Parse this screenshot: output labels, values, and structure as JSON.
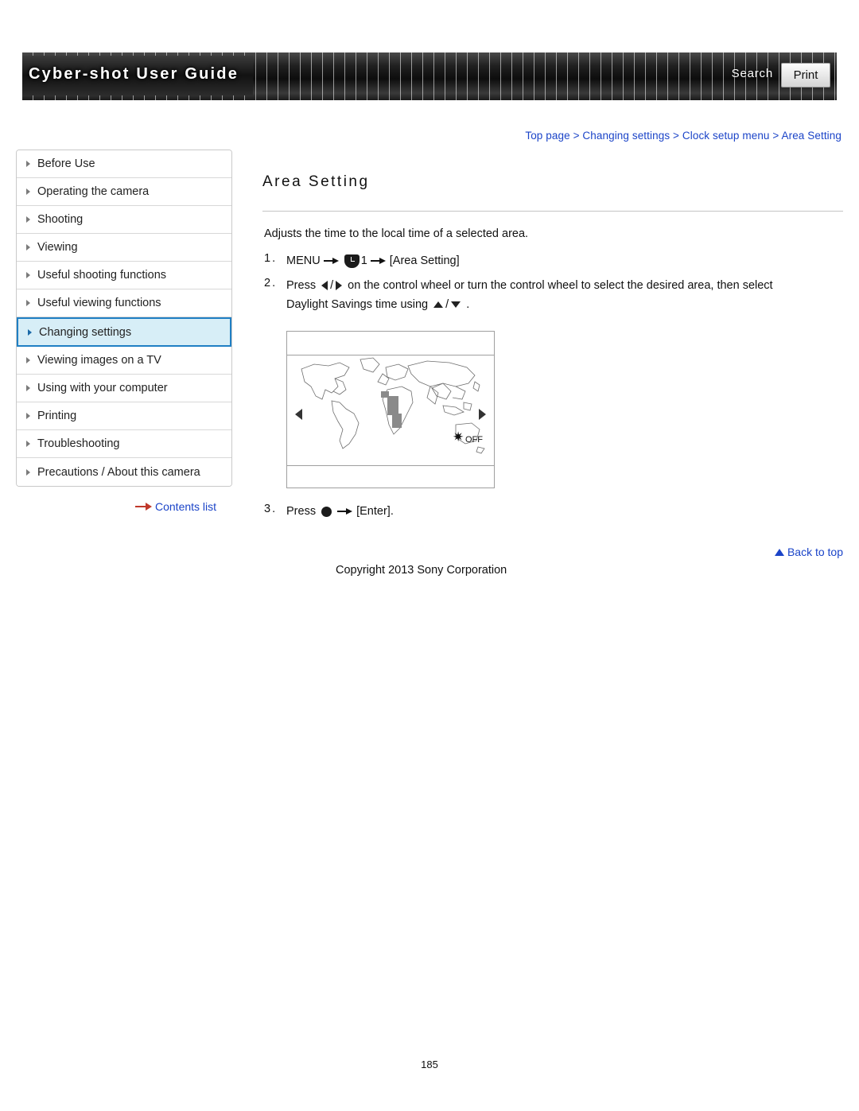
{
  "header": {
    "title": "Cyber-shot User Guide",
    "search_label": "Search",
    "print_label": "Print"
  },
  "breadcrumb": {
    "items": [
      "Top page",
      "Changing settings",
      "Clock setup menu",
      "Area Setting"
    ],
    "separator": ">"
  },
  "sidebar": {
    "items": [
      {
        "label": "Before Use"
      },
      {
        "label": "Operating the camera"
      },
      {
        "label": "Shooting"
      },
      {
        "label": "Viewing"
      },
      {
        "label": "Useful shooting functions"
      },
      {
        "label": "Useful viewing functions"
      },
      {
        "label": "Changing settings"
      },
      {
        "label": "Viewing images on a TV"
      },
      {
        "label": "Using with your computer"
      },
      {
        "label": "Printing"
      },
      {
        "label": "Troubleshooting"
      },
      {
        "label": "Precautions / About this camera"
      }
    ],
    "contents_list_label": "Contents list"
  },
  "main": {
    "title": "Area Setting",
    "intro": "Adjusts the time to the local time of a selected area.",
    "steps": [
      {
        "num": "1.",
        "part1": "MENU",
        "part2": "1",
        "part3": "[Area Setting]"
      },
      {
        "num": "2.",
        "t1": "Press",
        "t2": "/",
        "t3": "on the control wheel or turn the control wheel to select the desired area, then select",
        "t4": "Daylight Savings time using",
        "t5": "/",
        "t6": "."
      },
      {
        "num": "3.",
        "t1": "Press",
        "t2": "[Enter]."
      }
    ],
    "screen": {
      "dst_label": "OFF"
    }
  },
  "footer": {
    "back_to_top": "Back to top",
    "copyright": "Copyright 2013 Sony Corporation",
    "page_number": "185"
  }
}
